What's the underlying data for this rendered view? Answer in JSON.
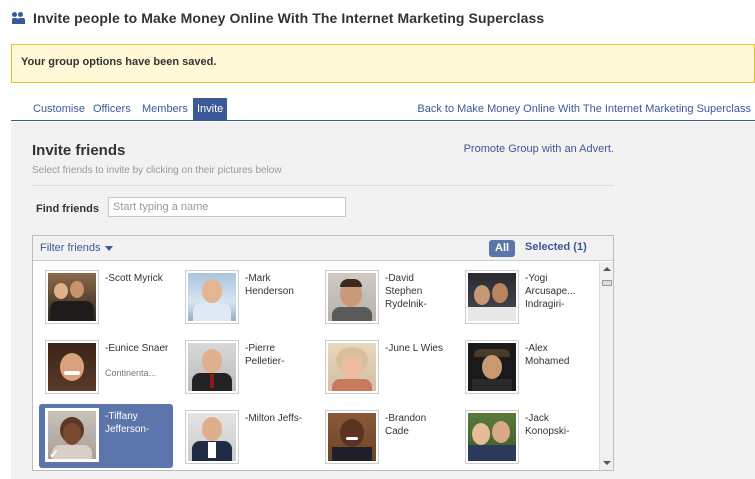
{
  "header": {
    "icon": "people-icon",
    "title": "Invite people to Make Money Online With The Internet Marketing Superclass"
  },
  "notice": {
    "text": "Your group options have been saved."
  },
  "tabs": [
    {
      "label": "Customise",
      "active": false
    },
    {
      "label": "Officers",
      "active": false
    },
    {
      "label": "Members",
      "active": false
    },
    {
      "label": "Invite",
      "active": true
    }
  ],
  "back_link": "Back to Make Money Online With The Internet Marketing Superclass",
  "invite": {
    "title": "Invite friends",
    "subtitle": "Select friends to invite by clicking on their pictures below",
    "promote_link": "Promote Group with an Advert.",
    "find_label": "Find friends",
    "find_placeholder": "Start typing a name"
  },
  "filter": {
    "label": "Filter friends",
    "all_label": "All",
    "selected_label": "Selected (1)"
  },
  "friends": [
    {
      "name": "-Scott Myrick",
      "network": "",
      "selected": false
    },
    {
      "name": "-Mark Henderson",
      "network": "",
      "selected": false
    },
    {
      "name": "-David Stephen Rydelnik-",
      "network": "",
      "selected": false
    },
    {
      "name": "-Yogi Arcusape... Indragiri-",
      "network": "",
      "selected": false
    },
    {
      "name": "-Eunice Snaer",
      "network": "Continenta...",
      "selected": false
    },
    {
      "name": "-Pierre Pelletier-",
      "network": "",
      "selected": false
    },
    {
      "name": "-June L Wies",
      "network": "",
      "selected": false
    },
    {
      "name": "-Alex Mohamed",
      "network": "",
      "selected": false
    },
    {
      "name": "-Tiffany Jefferson-",
      "network": "",
      "selected": true
    },
    {
      "name": "-Milton Jeffs-",
      "network": "",
      "selected": false
    },
    {
      "name": "-Brandon Cade",
      "network": "",
      "selected": false
    },
    {
      "name": "-Jack Konopski-",
      "network": "",
      "selected": false
    }
  ],
  "colors": {
    "brand": "#3b5998",
    "selected_bg": "#5c75aa",
    "notice_bg": "#fff9d7",
    "notice_border": "#e2c822"
  }
}
